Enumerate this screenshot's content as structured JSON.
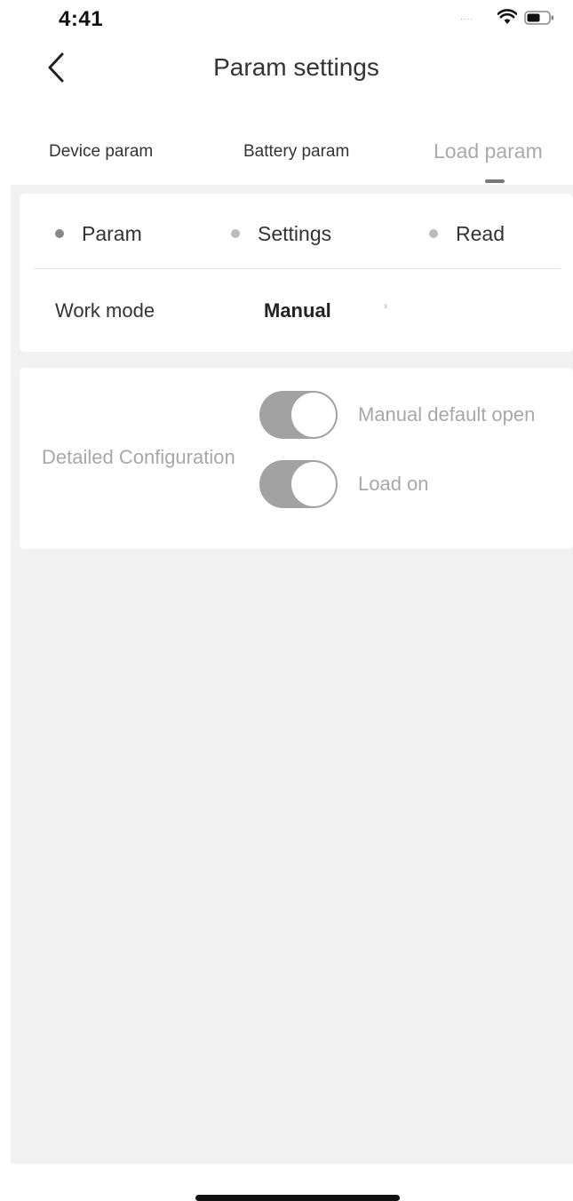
{
  "status_bar": {
    "time": "4:41",
    "signal": "....",
    "wifi_icon": "wifi-icon",
    "battery_icon": "battery-icon"
  },
  "nav": {
    "title": "Param settings",
    "back_icon": "chevron-left-icon"
  },
  "tabs": [
    {
      "label": "Device param",
      "active": false
    },
    {
      "label": "Battery param",
      "active": false
    },
    {
      "label": "Load param",
      "active": true
    }
  ],
  "steps": [
    {
      "label": "Param"
    },
    {
      "label": "Settings"
    },
    {
      "label": "Read"
    }
  ],
  "work_mode": {
    "label": "Work mode",
    "value": "Manual",
    "caret": "ᵌ"
  },
  "detailed_config": {
    "label": "Detailed Configuration",
    "toggles": [
      {
        "label": "Manual default open",
        "on": true
      },
      {
        "label": "Load on",
        "on": true
      }
    ]
  },
  "colors": {
    "toggle_track": "#a2a2a2",
    "content_background": "#f1f1f1",
    "muted_text": "#a8a8a8"
  }
}
